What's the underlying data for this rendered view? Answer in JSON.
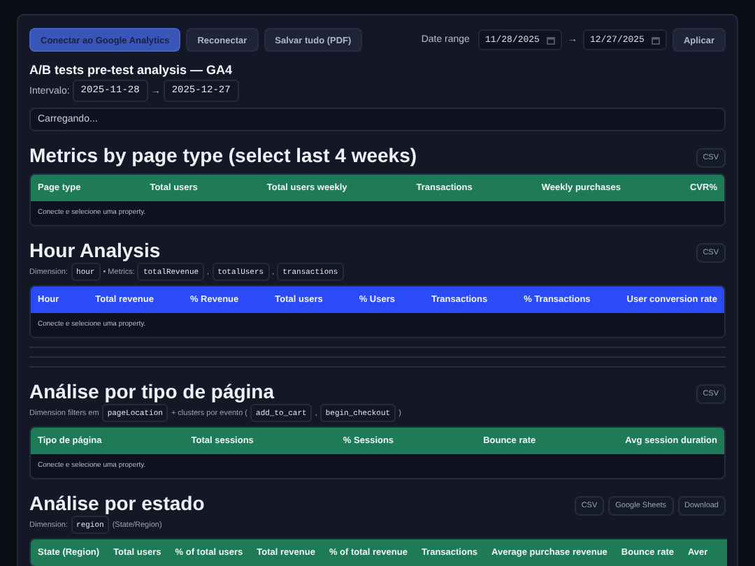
{
  "toolbar": {
    "buttons": [
      {
        "label": "Conectar ao Google Analytics",
        "kind": "primary"
      },
      {
        "label": "Reconectar",
        "kind": "secondary"
      },
      {
        "label": "Salvar tudo (PDF)",
        "kind": "secondary"
      }
    ],
    "date_range": {
      "label": "Date range",
      "start": "11/28/2025",
      "arrow": "→",
      "end": "12/27/2025",
      "apply": "Aplicar"
    }
  },
  "header": {
    "title": "A/B tests pre-test analysis — GA4",
    "interval_label": "Intervalo:",
    "start": "2025-11-28",
    "arrow": "→",
    "end": "2025-12-27"
  },
  "status": "Carregando...",
  "sections": [
    {
      "title": "Metrics by page type (select last 4 weeks)",
      "actions": [
        "CSV"
      ],
      "table": {
        "color": "#1f7a57",
        "columns": [
          "Page type",
          "Total users",
          "Total users weekly",
          "Transactions",
          "Weekly purchases",
          "CVR%"
        ],
        "empty": "Conecte e selecione uma property."
      }
    },
    {
      "title": "Hour Analysis",
      "actions": [
        "CSV"
      ],
      "meta": [
        {
          "kind": "text",
          "text": "Dimension:"
        },
        {
          "kind": "code",
          "text": "hour"
        },
        {
          "kind": "text",
          "text": "• Metrics:"
        },
        {
          "kind": "code",
          "text": "totalRevenue"
        },
        {
          "kind": "text",
          "text": ","
        },
        {
          "kind": "code",
          "text": "totalUsers"
        },
        {
          "kind": "text",
          "text": ","
        },
        {
          "kind": "code",
          "text": "transactions"
        }
      ],
      "table": {
        "color": "#2a4bf5",
        "columns": [
          "Hour",
          "Total revenue",
          "% Revenue",
          "Total users",
          "% Users",
          "Transactions",
          "% Transactions",
          "User conversion rate"
        ],
        "empty": "Conecte e selecione uma property."
      }
    },
    {
      "title": "Análise por tipo de página",
      "actions": [
        "CSV"
      ],
      "meta": [
        {
          "kind": "text",
          "text": "Dimension filters em"
        },
        {
          "kind": "code",
          "text": "pageLocation"
        },
        {
          "kind": "text",
          "text": "+ clusters por evento ("
        },
        {
          "kind": "code",
          "text": "add_to_cart"
        },
        {
          "kind": "text",
          "text": ","
        },
        {
          "kind": "code",
          "text": "begin_checkout"
        },
        {
          "kind": "text",
          "text": ")"
        }
      ],
      "table": {
        "color": "#1f7a57",
        "columns": [
          "Tipo de página",
          "Total sessions",
          "% Sessions",
          "Bounce rate",
          "Avg session duration"
        ],
        "empty": "Conecte e selecione uma property."
      }
    },
    {
      "title": "Análise por estado",
      "actions": [
        "CSV",
        "Google Sheets",
        "Download"
      ],
      "meta": [
        {
          "kind": "text",
          "text": "Dimension:"
        },
        {
          "kind": "code",
          "text": "region"
        },
        {
          "kind": "text",
          "text": "(State/Region)"
        }
      ],
      "table": {
        "color": "#1f7a57",
        "columns": [
          "State (Region)",
          "Total users",
          "% of total users",
          "Total revenue",
          "% of total revenue",
          "Transactions",
          "Average purchase revenue",
          "Bounce rate",
          "Aver"
        ]
      }
    }
  ]
}
